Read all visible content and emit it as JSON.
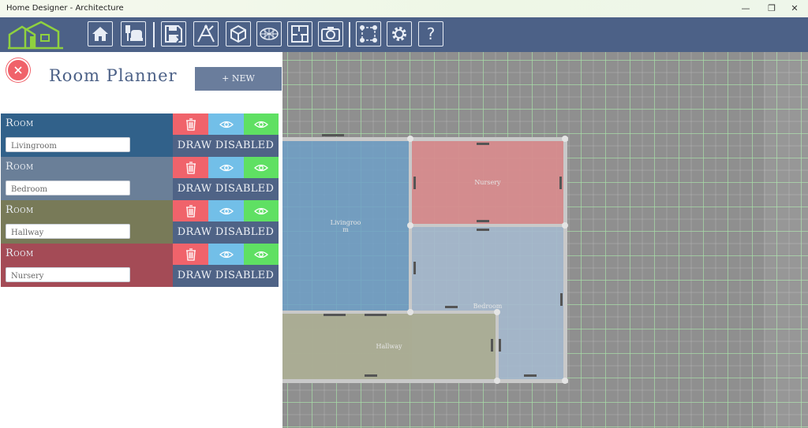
{
  "window": {
    "title": "Home Designer - Architecture",
    "controls": [
      "—",
      "❐",
      "✕"
    ]
  },
  "toolbar": {
    "buttons": [
      "home-icon",
      "furniture-icon",
      "save-icon",
      "compass-draw-icon",
      "cube-icon",
      "mesh-icon",
      "floorplan-icon",
      "camera-icon",
      "select-points-icon",
      "settings-icon",
      "help-icon"
    ],
    "help_label": "?"
  },
  "panel": {
    "title": "Room Planner",
    "new_button": "+ NEW",
    "rooms": [
      {
        "label": "Room",
        "name": "Livingroom",
        "draw": "DRAW DISABLED",
        "color": "#31618a"
      },
      {
        "label": "Room",
        "name": "Bedroom",
        "draw": "DRAW DISABLED",
        "color": "#6a7f98"
      },
      {
        "label": "Room",
        "name": "Hallway",
        "draw": "DRAW DISABLED",
        "color": "#787a58"
      },
      {
        "label": "Room",
        "name": "Nursery",
        "draw": "DRAW DISABLED",
        "color": "#a44b56"
      }
    ]
  },
  "canvas": {
    "rooms": {
      "livingroom": "Livingroom",
      "nursery": "Nursery",
      "bedroom": "Bedroom",
      "hallway": "Hallway"
    }
  },
  "colors": {
    "toolbar": "#4c6187",
    "delete": "#f0636b",
    "view": "#72bfe8",
    "view_alt": "#5fe063",
    "draw": "#4f6386"
  }
}
